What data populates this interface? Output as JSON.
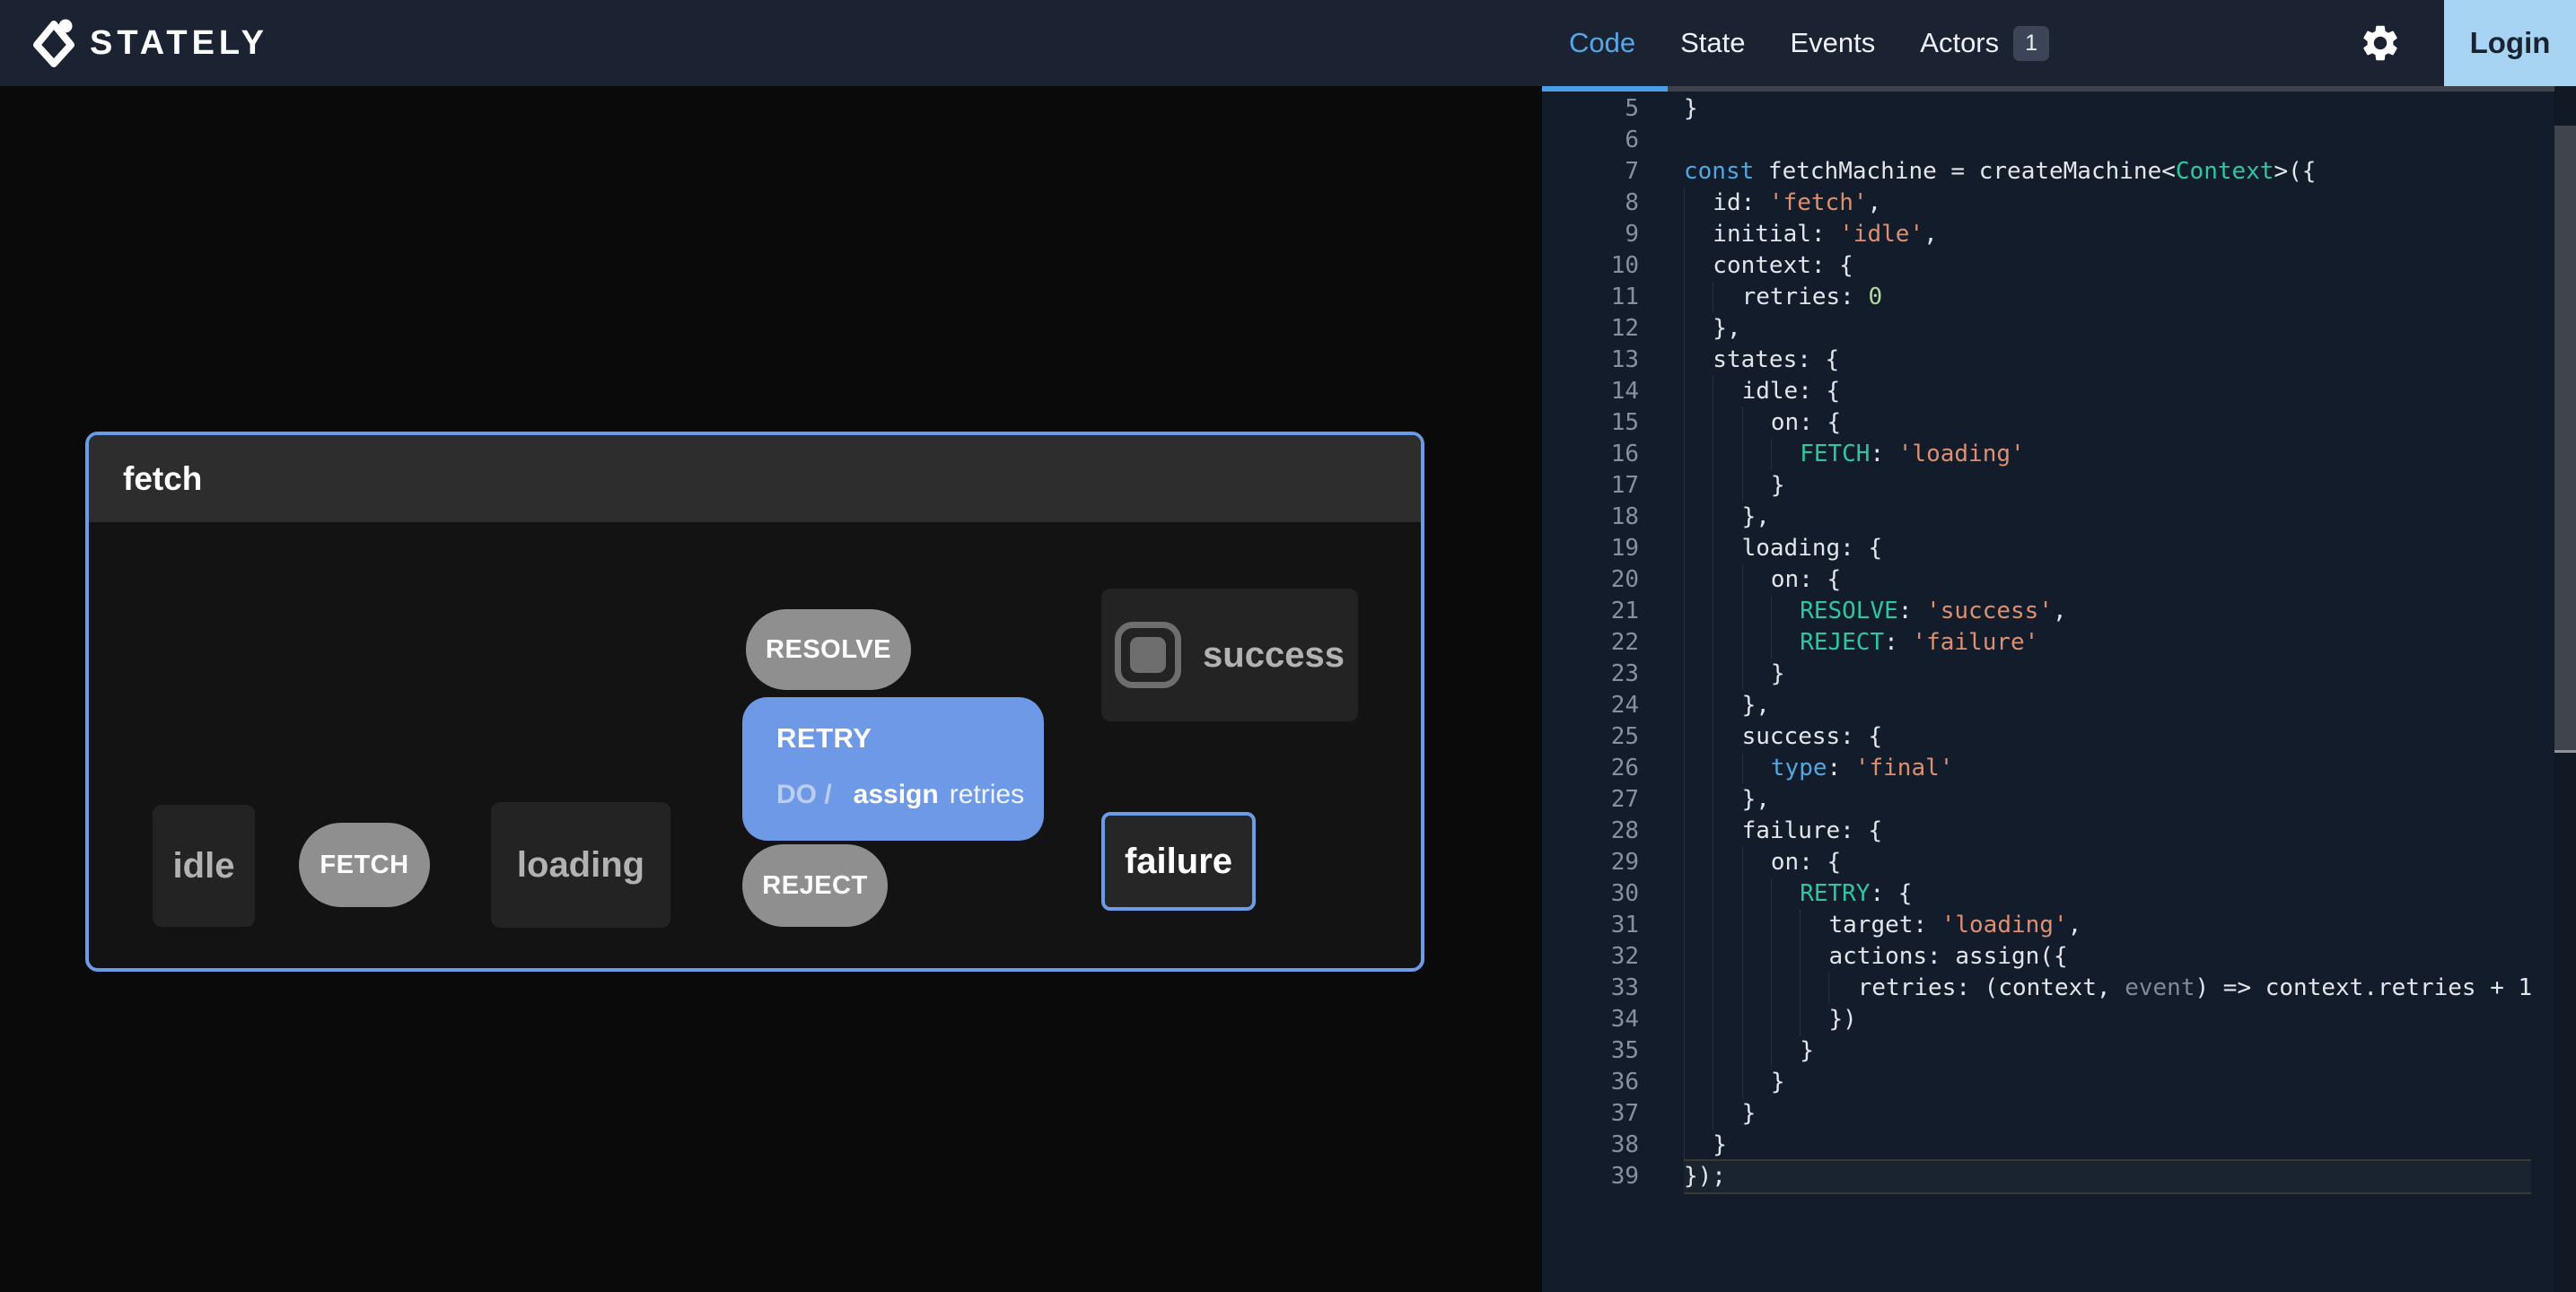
{
  "nav": {
    "logo_text": "STATELY",
    "tabs": [
      {
        "label": "Code",
        "active": true
      },
      {
        "label": "State",
        "active": false
      },
      {
        "label": "Events",
        "active": false
      },
      {
        "label": "Actors",
        "active": false,
        "badge": "1"
      }
    ],
    "login_label": "Login"
  },
  "diagram": {
    "machine_title": "fetch",
    "states": {
      "idle": "idle",
      "loading": "loading",
      "success": "success",
      "failure": "failure"
    },
    "events": {
      "fetch": "FETCH",
      "resolve": "RESOLVE",
      "reject": "REJECT",
      "retry": "RETRY"
    },
    "retry_action": {
      "prefix": "DO /",
      "name": "assign",
      "arg": "retries"
    }
  },
  "colors": {
    "accent_blue": "#57a7e6",
    "selection_blue": "#6b9ce8",
    "retry_blue": "#6d99e6",
    "login_bg": "#a8d4f3",
    "nav_bg": "#1b2332",
    "code_bg": "#131c2a",
    "keyword": "#52a7e0",
    "type_event": "#2fc6a2",
    "string": "#dd9070",
    "number": "#b5d99c"
  },
  "code": {
    "lines": [
      {
        "n": 5,
        "i": 0,
        "t": [
          [
            "p",
            "}"
          ]
        ]
      },
      {
        "n": 6,
        "i": 0,
        "t": []
      },
      {
        "n": 7,
        "i": 0,
        "t": [
          [
            "k",
            "const"
          ],
          [
            "p",
            " fetchMachine = createMachine<"
          ],
          [
            "t",
            "Context"
          ],
          [
            "p",
            ">({"
          ]
        ]
      },
      {
        "n": 8,
        "i": 1,
        "t": [
          [
            "p",
            "id: "
          ],
          [
            "s",
            "'fetch'"
          ],
          [
            "p",
            ","
          ]
        ]
      },
      {
        "n": 9,
        "i": 1,
        "t": [
          [
            "p",
            "initial: "
          ],
          [
            "s",
            "'idle'"
          ],
          [
            "p",
            ","
          ]
        ]
      },
      {
        "n": 10,
        "i": 1,
        "t": [
          [
            "p",
            "context: {"
          ]
        ]
      },
      {
        "n": 11,
        "i": 2,
        "t": [
          [
            "p",
            "retries: "
          ],
          [
            "n",
            "0"
          ]
        ]
      },
      {
        "n": 12,
        "i": 1,
        "t": [
          [
            "p",
            "},"
          ]
        ]
      },
      {
        "n": 13,
        "i": 1,
        "t": [
          [
            "p",
            "states: {"
          ]
        ]
      },
      {
        "n": 14,
        "i": 2,
        "t": [
          [
            "p",
            "idle: {"
          ]
        ]
      },
      {
        "n": 15,
        "i": 3,
        "t": [
          [
            "p",
            "on: {"
          ]
        ]
      },
      {
        "n": 16,
        "i": 4,
        "t": [
          [
            "t",
            "FETCH"
          ],
          [
            "p",
            ": "
          ],
          [
            "s",
            "'loading'"
          ]
        ]
      },
      {
        "n": 17,
        "i": 3,
        "t": [
          [
            "p",
            "}"
          ]
        ]
      },
      {
        "n": 18,
        "i": 2,
        "t": [
          [
            "p",
            "},"
          ]
        ]
      },
      {
        "n": 19,
        "i": 2,
        "t": [
          [
            "p",
            "loading: {"
          ]
        ]
      },
      {
        "n": 20,
        "i": 3,
        "t": [
          [
            "p",
            "on: {"
          ]
        ]
      },
      {
        "n": 21,
        "i": 4,
        "t": [
          [
            "t",
            "RESOLVE"
          ],
          [
            "p",
            ": "
          ],
          [
            "s",
            "'success'"
          ],
          [
            "p",
            ","
          ]
        ]
      },
      {
        "n": 22,
        "i": 4,
        "t": [
          [
            "t",
            "REJECT"
          ],
          [
            "p",
            ": "
          ],
          [
            "s",
            "'failure'"
          ]
        ]
      },
      {
        "n": 23,
        "i": 3,
        "t": [
          [
            "p",
            "}"
          ]
        ]
      },
      {
        "n": 24,
        "i": 2,
        "t": [
          [
            "p",
            "},"
          ]
        ]
      },
      {
        "n": 25,
        "i": 2,
        "t": [
          [
            "p",
            "success: {"
          ]
        ]
      },
      {
        "n": 26,
        "i": 3,
        "t": [
          [
            "k",
            "type"
          ],
          [
            "p",
            ": "
          ],
          [
            "s",
            "'final'"
          ]
        ]
      },
      {
        "n": 27,
        "i": 2,
        "t": [
          [
            "p",
            "},"
          ]
        ]
      },
      {
        "n": 28,
        "i": 2,
        "t": [
          [
            "p",
            "failure: {"
          ]
        ]
      },
      {
        "n": 29,
        "i": 3,
        "t": [
          [
            "p",
            "on: {"
          ]
        ]
      },
      {
        "n": 30,
        "i": 4,
        "t": [
          [
            "t",
            "RETRY"
          ],
          [
            "p",
            ": {"
          ]
        ]
      },
      {
        "n": 31,
        "i": 5,
        "t": [
          [
            "p",
            "target: "
          ],
          [
            "s",
            "'loading'"
          ],
          [
            "p",
            ","
          ]
        ]
      },
      {
        "n": 32,
        "i": 5,
        "t": [
          [
            "p",
            "actions: assign({"
          ]
        ]
      },
      {
        "n": 33,
        "i": 6,
        "t": [
          [
            "p",
            "retries: (context, "
          ],
          [
            "d",
            "event"
          ],
          [
            "p",
            ") => context.retries + 1"
          ]
        ]
      },
      {
        "n": 34,
        "i": 5,
        "t": [
          [
            "p",
            "})"
          ]
        ]
      },
      {
        "n": 35,
        "i": 4,
        "t": [
          [
            "p",
            "}"
          ]
        ]
      },
      {
        "n": 36,
        "i": 3,
        "t": [
          [
            "p",
            "}"
          ]
        ]
      },
      {
        "n": 37,
        "i": 2,
        "t": [
          [
            "p",
            "}"
          ]
        ]
      },
      {
        "n": 38,
        "i": 1,
        "t": [
          [
            "p",
            "}"
          ]
        ]
      },
      {
        "n": 39,
        "i": 0,
        "t": [
          [
            "p",
            "});"
          ]
        ],
        "active": true
      }
    ]
  }
}
